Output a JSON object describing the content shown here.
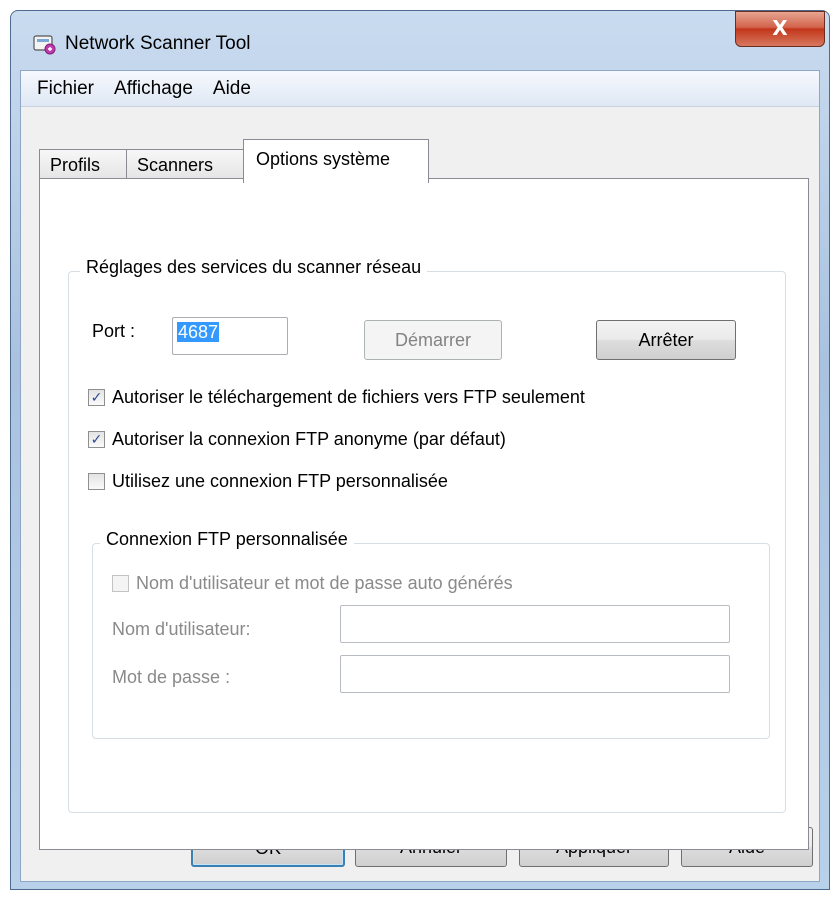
{
  "window": {
    "title": "Network Scanner Tool",
    "close_label": "X"
  },
  "menu": {
    "file": "Fichier",
    "view": "Affichage",
    "help": "Aide"
  },
  "tabs": {
    "profiles": "Profils",
    "scanners": "Scanners",
    "system_options": "Options système"
  },
  "service_group": {
    "title": "Réglages des services du scanner réseau",
    "port_label": "Port :",
    "port_value": "4687",
    "start_button": "Démarrer",
    "stop_button": "Arrêter",
    "options": [
      {
        "label": "Autoriser le téléchargement de fichiers vers FTP seulement",
        "checked": true
      },
      {
        "label": "Autoriser la connexion FTP anonyme (par défaut)",
        "checked": true
      },
      {
        "label": "Utilisez une connexion FTP personnalisée",
        "checked": false
      }
    ]
  },
  "custom_ftp_group": {
    "title": "Connexion FTP personnalisée",
    "auto_generate_label": "Nom d'utilisateur et mot de passe auto générés",
    "username_label": "Nom d'utilisateur:",
    "username_value": "",
    "password_label": "Mot de passe :",
    "password_value": ""
  },
  "footer": {
    "ok": "OK",
    "cancel": "Annuler",
    "apply": "Appliquer",
    "help": "Aide"
  },
  "colors": {
    "selection": "#3399ff",
    "close_button": "#c2361a",
    "default_button_border": "#3c7fb1"
  }
}
